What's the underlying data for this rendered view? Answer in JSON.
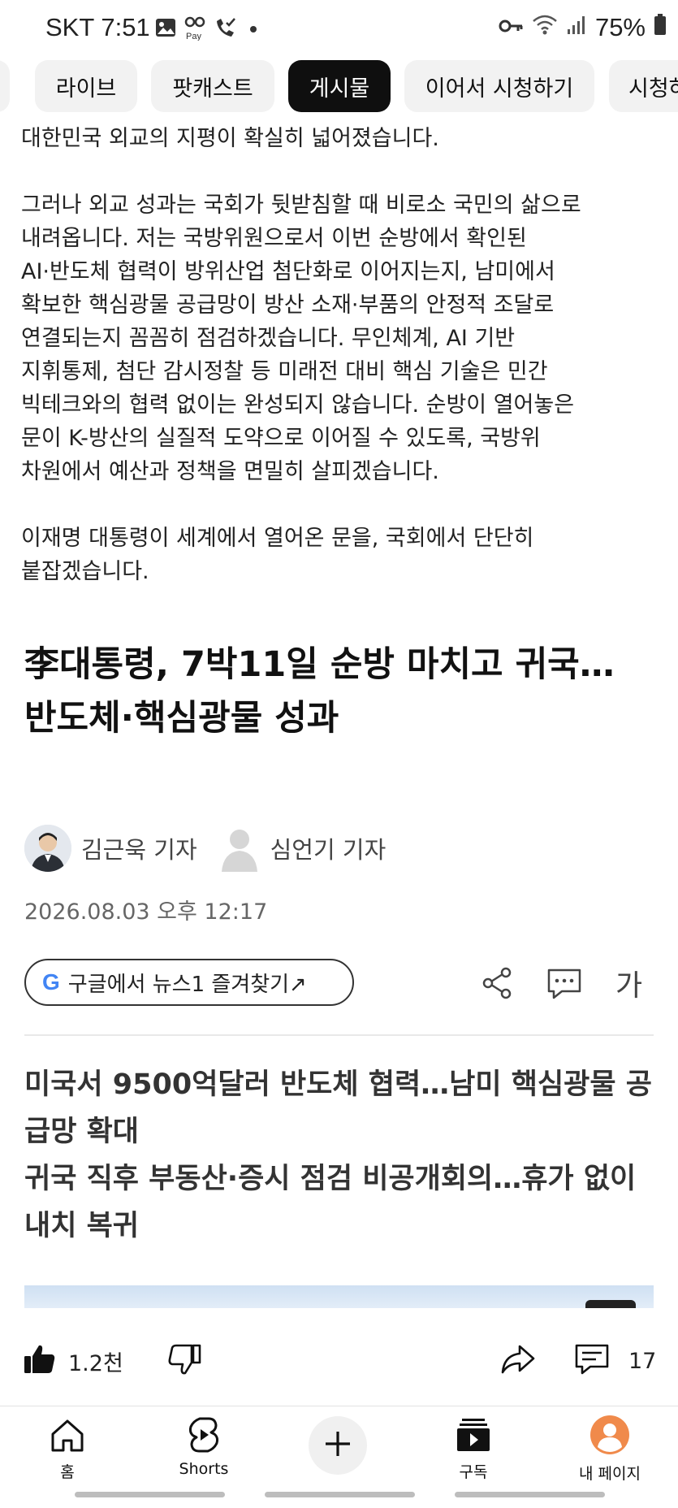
{
  "status_bar": {
    "carrier_time": "SKT 7:51",
    "battery": "75%",
    "icons": [
      "gallery-icon",
      "pay-icon",
      "call-icon",
      "dot-icon",
      "key-icon",
      "wifi-icon",
      "signal-icon",
      "battery-icon"
    ],
    "pay_label": "Pay"
  },
  "chips": [
    {
      "label": "라이브",
      "active": false
    },
    {
      "label": "팟캐스트",
      "active": false
    },
    {
      "label": "게시물",
      "active": true
    },
    {
      "label": "이어서 시청하기",
      "active": false
    },
    {
      "label": "시청하",
      "active": false
    }
  ],
  "article": {
    "para1": "대한민국 외교의 지평이 확실히 넓어졌습니다.",
    "para2": "그러나 외교 성과는 국회가 뒷받침할 때 비로소 국민의 삶으로\n내려옵니다. 저는 국방위원으로서 이번 순방에서 확인된\nAI·반도체 협력이 방위산업 첨단화로 이어지는지, 남미에서\n확보한 핵심광물 공급망이 방산 소재·부품의 안정적 조달로\n연결되는지 꼼꼼히 점검하겠습니다. 무인체계, AI 기반\n지휘통제, 첨단 감시정찰 등 미래전 대비 핵심 기술은 민간\n빅테크와의 협력 없이는 완성되지 않습니다. 순방이 열어놓은\n문이 K-방산의 실질적 도약으로 이어질 수 있도록, 국방위\n차원에서 예산과 정책을 면밀히 살피겠습니다.",
    "para3": "이재명 대통령이 세계에서 열어온 문을, 국회에서 단단히\n붙잡겠습니다.",
    "headline": "李대통령, 7박11일 순방 마치고 귀국…반도체·핵심광물 성과",
    "author1": "김근욱 기자",
    "author2": "심언기 기자",
    "date": "2026.08.03 오후 12:17",
    "google_button": "구글에서 뉴스1 즐겨찾기↗",
    "font_size_label": "가",
    "summary1": "미국서 9500억달러 반도체 협력…남미 핵심광물 공급망 확대",
    "summary2": "귀국 직후 부동산·증시 점검 비공개회의…휴가 없이 내치 복귀"
  },
  "actions": {
    "likes": "1.2천",
    "comments": "17"
  },
  "nav": {
    "home": "홈",
    "shorts": "Shorts",
    "subscriptions": "구독",
    "mypage": "내 페이지"
  },
  "colors": {
    "chip_bg": "#f2f2f2",
    "chip_active": "#0f0f0f",
    "avatar_orange": "#f08a4b",
    "google_blue": "#4285F4"
  }
}
